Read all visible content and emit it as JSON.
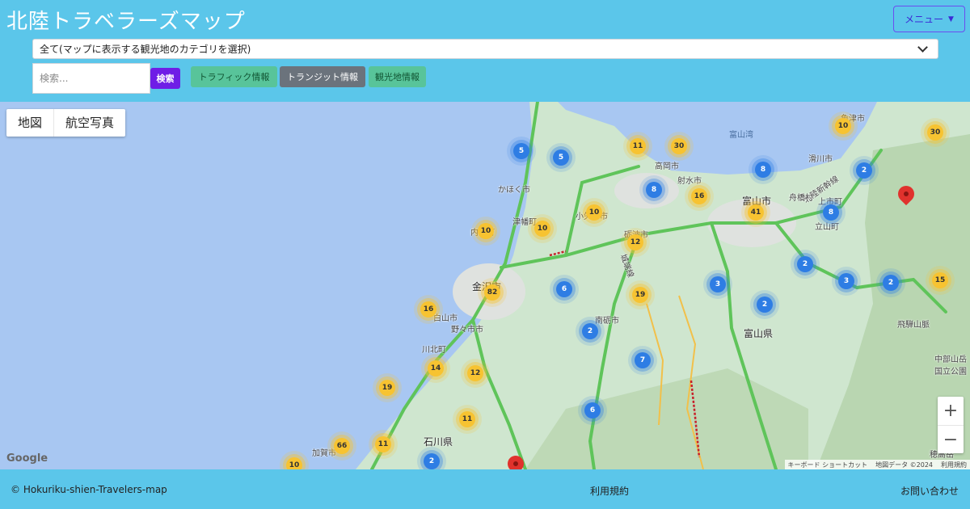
{
  "header": {
    "title": "北陸トラベラーズマップ",
    "menu_label": "メニュー"
  },
  "filters": {
    "category_selected": "全て(マップに表示する観光地のカテゴリを選択)",
    "search_placeholder": "検索...",
    "search_button": "検索",
    "traffic_button": "トラフィック情報",
    "transit_button": "トランジット情報",
    "sights_button": "観光地情報"
  },
  "map": {
    "type_map": "地図",
    "type_satellite": "航空写真",
    "zoom_in": "+",
    "zoom_out": "−",
    "google_logo": "Google",
    "attribution": [
      "キーボード ショートカット",
      "地図データ ©2024",
      "利用規約"
    ],
    "clusters": [
      {
        "count": "5",
        "color": "blue"
      },
      {
        "count": "5",
        "color": "blue"
      },
      {
        "count": "11",
        "color": "yellow"
      },
      {
        "count": "30",
        "color": "yellow"
      },
      {
        "count": "10",
        "color": "yellow"
      },
      {
        "count": "30",
        "color": "yellow"
      },
      {
        "count": "8",
        "color": "blue"
      },
      {
        "count": "2",
        "color": "blue"
      },
      {
        "count": "8",
        "color": "blue"
      },
      {
        "count": "16",
        "color": "yellow"
      },
      {
        "count": "41",
        "color": "yellow"
      },
      {
        "count": "8",
        "color": "blue"
      },
      {
        "count": "10",
        "color": "yellow"
      },
      {
        "count": "10",
        "color": "yellow"
      },
      {
        "count": "10",
        "color": "yellow"
      },
      {
        "count": "12",
        "color": "yellow"
      },
      {
        "count": "82",
        "color": "yellow"
      },
      {
        "count": "6",
        "color": "blue"
      },
      {
        "count": "3",
        "color": "blue"
      },
      {
        "count": "2",
        "color": "blue"
      },
      {
        "count": "3",
        "color": "blue"
      },
      {
        "count": "2",
        "color": "blue"
      },
      {
        "count": "15",
        "color": "yellow"
      },
      {
        "count": "16",
        "color": "yellow"
      },
      {
        "count": "19",
        "color": "yellow"
      },
      {
        "count": "2",
        "color": "blue"
      },
      {
        "count": "2",
        "color": "blue"
      },
      {
        "count": "7",
        "color": "blue"
      },
      {
        "count": "14",
        "color": "yellow"
      },
      {
        "count": "12",
        "color": "yellow"
      },
      {
        "count": "19",
        "color": "yellow"
      },
      {
        "count": "11",
        "color": "yellow"
      },
      {
        "count": "6",
        "color": "blue"
      },
      {
        "count": "66",
        "color": "yellow"
      },
      {
        "count": "11",
        "color": "yellow"
      },
      {
        "count": "2",
        "color": "blue"
      },
      {
        "count": "10",
        "color": "yellow"
      }
    ],
    "place_labels": [
      "富山湾",
      "滑川市",
      "北陸新幹線",
      "高岡市",
      "射水市",
      "富山市",
      "舟橋村",
      "上市町",
      "立山町",
      "かほく市",
      "津幡町",
      "小矢部市",
      "砺波市",
      "内灘町",
      "金沢市",
      "白山市",
      "野々市市",
      "南砺市",
      "富山県",
      "川北町",
      "飛騨山脈",
      "中部山岳国立公園",
      "石川県",
      "加賀市",
      "穂高岳",
      "魚津市",
      "城端線"
    ]
  },
  "footer": {
    "copyright": "© Hokuriku-shien-Travelers-map",
    "terms": "利用規約",
    "contact": "お問い合わせ"
  }
}
